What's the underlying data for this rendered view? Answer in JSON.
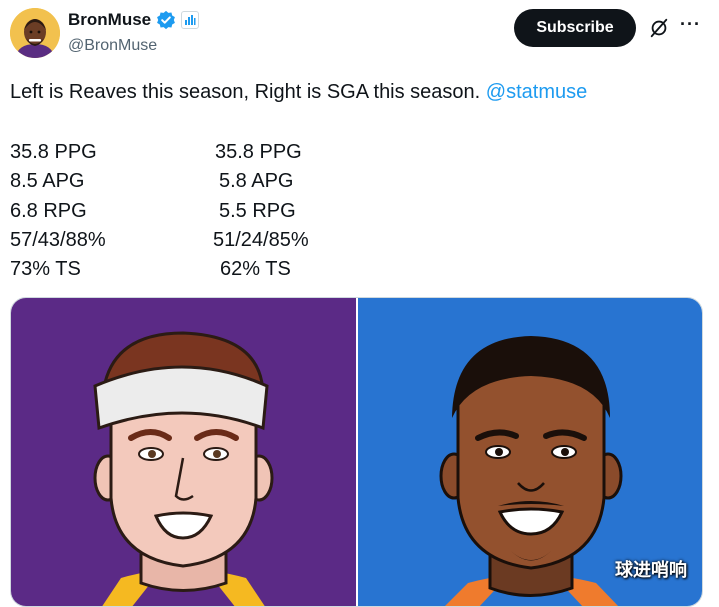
{
  "author": {
    "display_name": "BronMuse",
    "handle": "@BronMuse",
    "avatar_icon": "lebron-cartoon-avatar",
    "verified_icon": "blue-verified-badge-icon",
    "affiliate_icon": "affiliate-badge-icon"
  },
  "actions": {
    "subscribe_label": "Subscribe",
    "grok_icon": "grok-icon",
    "more_icon": "more-options-icon"
  },
  "tweet": {
    "text": "Left is Reaves this season, Right is SGA this season. ",
    "mention": "@statmuse"
  },
  "stats": [
    {
      "left": "35.8 PPG",
      "right": "35.8 PPG"
    },
    {
      "left": "8.5 APG",
      "right": "5.8 APG"
    },
    {
      "left": "6.8 RPG",
      "right": "5.5 RPG"
    },
    {
      "left": "57/43/88%",
      "right": "51/24/85%"
    },
    {
      "left": "73% TS",
      "right": "62% TS"
    }
  ],
  "media": {
    "left_panel": {
      "subject": "reaves-cartoon-illustration",
      "background": "#5b2a86"
    },
    "right_panel": {
      "subject": "sga-cartoon-illustration",
      "background": "#2874d1"
    }
  },
  "watermark": "球进哨响",
  "colors": {
    "accent": "#1d9bf0",
    "text": "#0f1419",
    "muted": "#536471"
  }
}
